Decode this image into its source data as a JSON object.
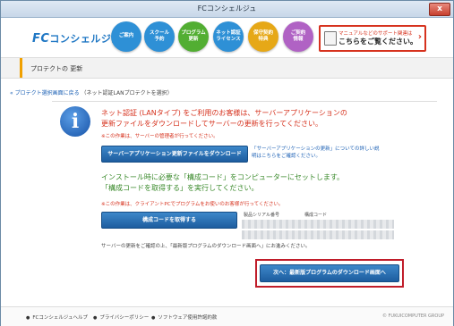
{
  "window": {
    "title": "FCコンシェルジュ",
    "close_label": "x"
  },
  "logo": {
    "fc": "FC",
    "text": "コンシェルジュ"
  },
  "nav": [
    {
      "label": "ご案内",
      "color": "#2e90d6"
    },
    {
      "label": "スクール\n予約",
      "color": "#2e90d6"
    },
    {
      "label": "プログラム\n更新",
      "color": "#52ae32"
    },
    {
      "label": "ネット認証\nライセンス",
      "color": "#2e90d6"
    },
    {
      "label": "保守契約\n特典",
      "color": "#e6a817"
    },
    {
      "label": "ご契約\n情報",
      "color": "#b062c4"
    }
  ],
  "support": {
    "line1": "マニュアルなどのサポート関連は",
    "line2": "こちらをご覧ください。",
    "chevron": "›"
  },
  "section": {
    "title": "プロテクトの 更新"
  },
  "back": {
    "link": "« プロテクト選択画面に戻る",
    "sub": "（ネット認証LANプロテクトを選択）"
  },
  "info_icon": "i",
  "message": {
    "line1": "ネット認証 (LANタイプ) をご利用のお客様は、サーバーアプリケーションの",
    "line2": "更新ファイルをダウンロードしてサーバーの更新を行ってください。",
    "note": "※この作業は、サーバーの管理者が行ってください。"
  },
  "download_button": "サーバーアプリケーション更新ファイルをダウンロード",
  "download_link": {
    "line1": "「サーバーアプリケーションの更新」についての詳しい説",
    "line2": "明はこちらをご確認ください。"
  },
  "install": {
    "line1": "インストール時に必要な「構成コード」をコンピューターにセットします。",
    "line2": "「構成コードを取得する」を実行してください。",
    "note": "※この作業は、クライアントPCでプログラムをお使いのお客様が行ってください。"
  },
  "get_code_button": "構成コードを取得する",
  "table": {
    "col1": "製品シリアル番号",
    "col2": "構成コード"
  },
  "bottom_note": "サーバーの更新をご確認の上、「最新版プログラムのダウンロード画面へ」にお進みください。",
  "next_button": "次へ：最新版プログラムのダウンロード画面へ",
  "footer": {
    "links": [
      "FCコンシェルジュヘルプ",
      "プライバシーポリシー",
      "ソフトウェア使用許諾約款"
    ],
    "copyright": "© FUKUICOMPUTER GROUP"
  }
}
